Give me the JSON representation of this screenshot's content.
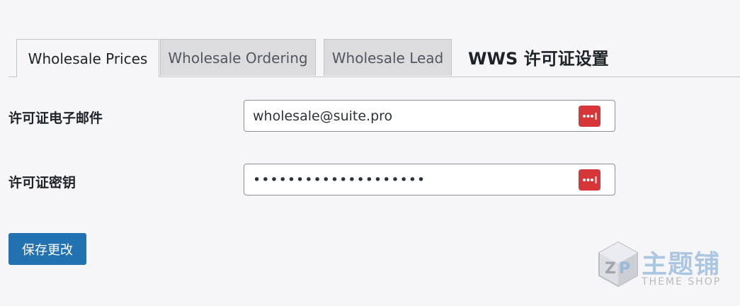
{
  "tabs": [
    {
      "label": "Wholesale Prices",
      "active": true
    },
    {
      "label": "Wholesale Ordering",
      "active": false
    },
    {
      "label": "Wholesale Lead",
      "active": false
    }
  ],
  "section_title": "WWS 许可证设置",
  "fields": {
    "email": {
      "label": "许可证电子邮件",
      "value": "wholesale@suite.pro",
      "icon": "password-manager-icon"
    },
    "license_key": {
      "label": "许可证密钥",
      "value": "••••••••••••••••••••",
      "icon": "password-manager-icon"
    }
  },
  "save_button": {
    "label": "保存更改"
  },
  "watermark": {
    "cn": "主题铺",
    "en": "THEME SHOP"
  },
  "colors": {
    "primary": "#2271b1",
    "icon_red": "#d63638",
    "tab_inactive_bg": "#dcdcde",
    "page_bg": "#f6f6f8"
  }
}
